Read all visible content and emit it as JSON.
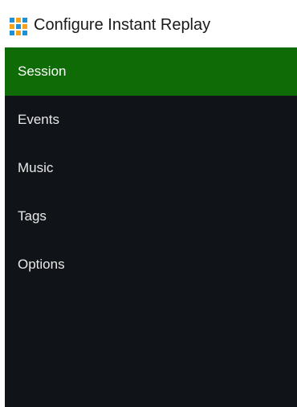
{
  "window": {
    "title": "Configure Instant Replay",
    "icon": "app-grid-icon",
    "icon_colors": [
      "#1e90d6",
      "#f2a21b",
      "#1e90d6",
      "#f2a21b",
      "#1e90d6",
      "#f2a21b",
      "#1e90d6",
      "#f2a21b",
      "#1e90d6"
    ]
  },
  "sidebar": {
    "background": "#101318",
    "active_color": "#0f6b06",
    "items": [
      {
        "label": "Session",
        "active": true
      },
      {
        "label": "Events",
        "active": false
      },
      {
        "label": "Music",
        "active": false
      },
      {
        "label": "Tags",
        "active": false
      },
      {
        "label": "Options",
        "active": false
      }
    ]
  }
}
